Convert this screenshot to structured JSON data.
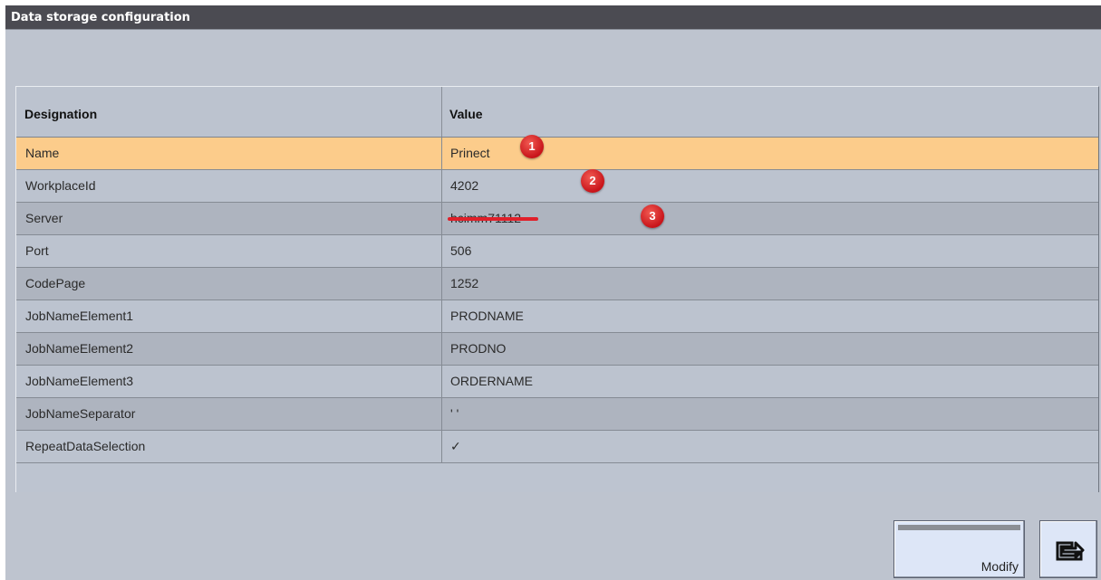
{
  "window": {
    "title": "Data storage configuration"
  },
  "table": {
    "headers": {
      "designation": "Designation",
      "value": "Value"
    },
    "rows": [
      {
        "designation": "Name",
        "value": "Prinect",
        "selected": true
      },
      {
        "designation": "WorkplaceId",
        "value": "4202"
      },
      {
        "designation": "Server",
        "value": "hcimm71112"
      },
      {
        "designation": "Port",
        "value": "506"
      },
      {
        "designation": "CodePage",
        "value": "1252"
      },
      {
        "designation": "JobNameElement1",
        "value": "PRODNAME"
      },
      {
        "designation": "JobNameElement2",
        "value": "PRODNO"
      },
      {
        "designation": "JobNameElement3",
        "value": "ORDERNAME"
      },
      {
        "designation": "JobNameSeparator",
        "value": "' '"
      },
      {
        "designation": "RepeatDataSelection",
        "value": "✓"
      }
    ]
  },
  "annotations": {
    "badge1": "1",
    "badge2": "2",
    "badge3": "3"
  },
  "buttons": {
    "modify_label": "Modify",
    "exit_icon": "exit-return-icon"
  },
  "colors": {
    "titlebar": "#4b4b52",
    "background": "#bec4cf",
    "selected_row": "#fccc8b",
    "badge": "#d41c20",
    "button": "#dde6f7"
  }
}
